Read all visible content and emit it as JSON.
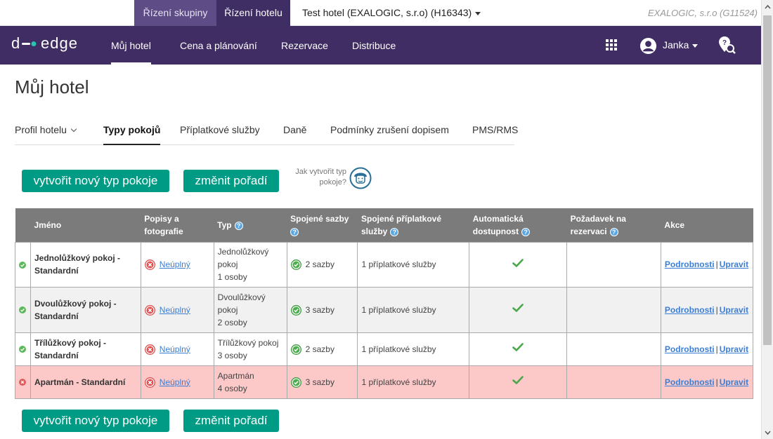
{
  "topbar": {
    "group_tab": "Řízení skupiny",
    "hotel_tab": "Řízení hotelu",
    "hotel_select": "Test hotel (EXALOGIC, s.r.o) (H16343)",
    "company": "EXALOGIC, s.r.o (G11524)"
  },
  "nav": {
    "logo": "d-edge",
    "items": [
      "Můj hotel",
      "Cena a plánování",
      "Rezervace",
      "Distribuce"
    ],
    "user": "Janka",
    "brand_color": "#3f2d63"
  },
  "page": {
    "title": "Můj hotel",
    "subnav": [
      "Profil hotelu",
      "Typy pokojů",
      "Příplatkové služby",
      "Daně",
      "Podmínky zrušení dopisem",
      "PMS/RMS"
    ],
    "btn_new": "vytvořit nový typ pokoje",
    "btn_order": "změnit pořadí",
    "howto": "Jak vytvořit typ pokoje?",
    "accent_color": "#009b84"
  },
  "table": {
    "headers": {
      "name": "Jméno",
      "desc": "Popisy a fotografie",
      "type": "Typ",
      "rates": "Spojené sazby",
      "services": "Spojené příplatkové služby",
      "auto": "Automatická dostupnost",
      "request": "Požadavek na rezervaci",
      "actions": "Akce"
    },
    "rows": [
      {
        "status": "ok",
        "name": "Jednolůžkový pokoj - Standardní",
        "desc": "Neúplný",
        "type1": "Jednolůžkový pokoj",
        "type2": "1 osoby",
        "rates": "2 sazby",
        "services": "1 příplatkové služby",
        "details": "Podrobnosti",
        "edit": "Upravit"
      },
      {
        "status": "ok",
        "name": "Dvoulůžkový pokoj - Standardní",
        "desc": "Neúplný",
        "type1": "Dvoulůžkový pokoj",
        "type2": "2 osoby",
        "rates": "3 sazby",
        "services": "1 příplatkové služby",
        "details": "Podrobnosti",
        "edit": "Upravit"
      },
      {
        "status": "ok",
        "name": "Třílůžkový pokoj - Standardní",
        "desc": "Neúplný",
        "type1": "Třílůžkový pokoj",
        "type2": "3 osoby",
        "rates": "2 sazby",
        "services": "1 příplatkové služby",
        "details": "Podrobnosti",
        "edit": "Upravit"
      },
      {
        "status": "error",
        "name": "Apartmán - Standardní",
        "desc": "Neúplný",
        "type1": "Apartmán",
        "type2": "4 osoby",
        "rates": "3 sazby",
        "services": "1 příplatkové služby",
        "details": "Podrobnosti",
        "edit": "Upravit"
      }
    ],
    "separator": "|"
  }
}
